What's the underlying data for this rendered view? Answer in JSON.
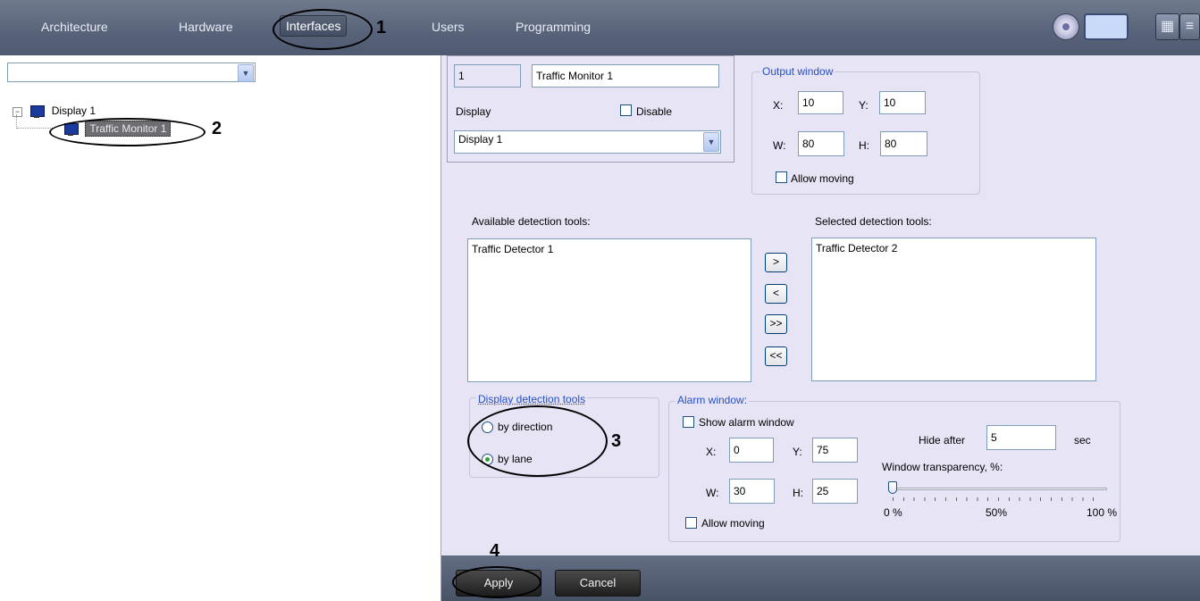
{
  "nav": {
    "tabs": [
      "Architecture",
      "Hardware",
      "Interfaces",
      "Users",
      "Programming"
    ],
    "active": "Interfaces"
  },
  "top": {
    "icon": "compass-icon",
    "search_value": "",
    "grid_icon": "grid-view-icon",
    "menu_icon": "menu-icon"
  },
  "tree": {
    "select_value": "",
    "nodes": [
      {
        "label": "Display 1",
        "icon": "monitor-icon",
        "expanded": true
      },
      {
        "label": "Traffic Monitor 1",
        "icon": "monitor-icon",
        "selected": true
      }
    ]
  },
  "callouts": [
    "1",
    "2",
    "3",
    "4"
  ],
  "form": {
    "id_value": "1",
    "name_value": "Traffic Monitor 1",
    "display_label": "Display",
    "disable_label": "Disable",
    "display_select": "Display 1",
    "output_window": {
      "title": "Output window",
      "x_label": "X:",
      "x": "10",
      "y_label": "Y:",
      "y": "10",
      "w_label": "W:",
      "w": "80",
      "h_label": "H:",
      "h": "80",
      "allow_moving": "Allow moving"
    },
    "available_label": "Available detection tools:",
    "available_items": [
      "Traffic Detector 1"
    ],
    "selected_label": "Selected detection tools:",
    "selected_items": [
      "Traffic Detector 2"
    ],
    "move_buttons": [
      ">",
      "<",
      ">>",
      "<<"
    ],
    "display_tools": {
      "title": "Display detection tools",
      "by_direction": "by direction",
      "by_lane": "by lane",
      "selected": "by lane"
    },
    "alarm": {
      "title": "Alarm window:",
      "show": "Show alarm window",
      "x_label": "X:",
      "x": "0",
      "y_label": "Y:",
      "y": "75",
      "w_label": "W:",
      "w": "30",
      "h_label": "H:",
      "h": "25",
      "allow_moving": "Allow moving",
      "hide_after_label": "Hide after",
      "hide_after_value": "5",
      "sec": "sec",
      "transparency_label": "Window transparency, %:",
      "transparency_value": 0,
      "ticks": [
        "0 %",
        "50%",
        "100 %"
      ]
    }
  },
  "buttons": {
    "apply": "Apply",
    "cancel": "Cancel"
  }
}
